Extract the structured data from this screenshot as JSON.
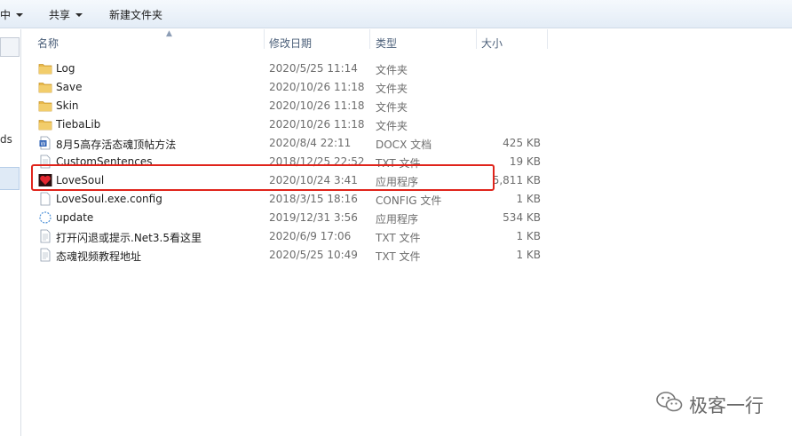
{
  "toolbar": {
    "partial_label": "中",
    "share_label": "共享",
    "new_folder_label": "新建文件夹"
  },
  "nav": {
    "partial_text": "ds"
  },
  "columns": {
    "name": "名称",
    "modified": "修改日期",
    "type": "类型",
    "size": "大小"
  },
  "files": [
    {
      "name": "Log",
      "modified": "2020/5/25 11:14",
      "type": "文件夹",
      "size": "",
      "icon": "folder-icon"
    },
    {
      "name": "Save",
      "modified": "2020/10/26 11:18",
      "type": "文件夹",
      "size": "",
      "icon": "folder-icon"
    },
    {
      "name": "Skin",
      "modified": "2020/10/26 11:18",
      "type": "文件夹",
      "size": "",
      "icon": "folder-icon"
    },
    {
      "name": "TiebaLib",
      "modified": "2020/10/26 11:18",
      "type": "文件夹",
      "size": "",
      "icon": "folder-icon"
    },
    {
      "name": "8月5高存活态魂顶帖方法",
      "modified": "2020/8/4 22:11",
      "type": "DOCX 文档",
      "size": "425 KB",
      "icon": "word-doc-icon"
    },
    {
      "name": "CustomSentences",
      "modified": "2018/12/25 22:52",
      "type": "TXT 文件",
      "size": "19 KB",
      "icon": "text-file-icon"
    },
    {
      "name": "LoveSoul",
      "modified": "2020/10/24 3:41",
      "type": "应用程序",
      "size": "5,811 KB",
      "icon": "heart-app-icon"
    },
    {
      "name": "LoveSoul.exe.config",
      "modified": "2018/3/15 18:16",
      "type": "CONFIG 文件",
      "size": "1 KB",
      "icon": "config-file-icon"
    },
    {
      "name": "update",
      "modified": "2019/12/31 3:56",
      "type": "应用程序",
      "size": "534 KB",
      "icon": "update-app-icon"
    },
    {
      "name": "打开闪退或提示.Net3.5看这里",
      "modified": "2020/6/9 17:06",
      "type": "TXT 文件",
      "size": "1 KB",
      "icon": "text-file-icon"
    },
    {
      "name": "态魂视频教程地址",
      "modified": "2020/5/25 10:49",
      "type": "TXT 文件",
      "size": "1 KB",
      "icon": "text-file-icon"
    }
  ],
  "watermark": {
    "text": "极客一行",
    "icon": "wechat-icon"
  },
  "colors": {
    "highlight": "#e0241b",
    "folder": "#e8b84a",
    "header_text": "#4c607a"
  }
}
